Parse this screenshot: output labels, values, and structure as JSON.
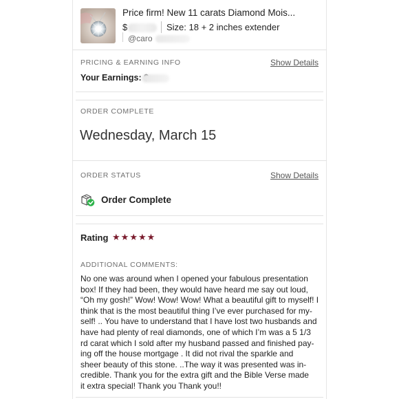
{
  "listing": {
    "title": "Price firm! New 11 carats Diamond Mois...",
    "price_prefix": "$",
    "size": "Size: 18 + 2 inches extender",
    "handle_prefix": "@caro"
  },
  "pricing": {
    "section_label": "PRICING & EARNING INFO",
    "show_details": "Show Details",
    "earnings_label": "Your Earnings: $"
  },
  "order_complete": {
    "section_label": "ORDER COMPLETE",
    "date": "Wednesday, March 15"
  },
  "order_status": {
    "section_label": "ORDER STATUS",
    "show_details": "Show Details",
    "status": "Order Complete",
    "icon": "package-check-icon",
    "icon_color": "#2db34a"
  },
  "rating": {
    "label": "Rating",
    "stars": 5,
    "max_stars": 5,
    "star_color": "#7a1b2d"
  },
  "comments": {
    "label": "ADDITIONAL COMMENTS:",
    "lines": [
      "No one was around when I opened your fabulous presentation",
      "box! If they had been, they would have heard me say out loud,",
      "“Oh my gosh!” Wow! Wow! Wow! What a beautiful gift to myself! I",
      "think that is the most beautiful thing I’ve ever purchased for my-",
      "self! .. You have to understand that I have lost two husbands and",
      "have had plenty of real diamonds, one of which I’m was a 5 1/3",
      "rd carat which I sold after my husband passed and finished pay-",
      "ing off the house mortgage . It did not rival the sparkle and",
      "sheer beauty of this stone. ..The way it was presented was in-",
      "credible. Thank you for the extra gift and the Bible Verse made",
      "it extra special! Thank you Thank you!!"
    ]
  }
}
